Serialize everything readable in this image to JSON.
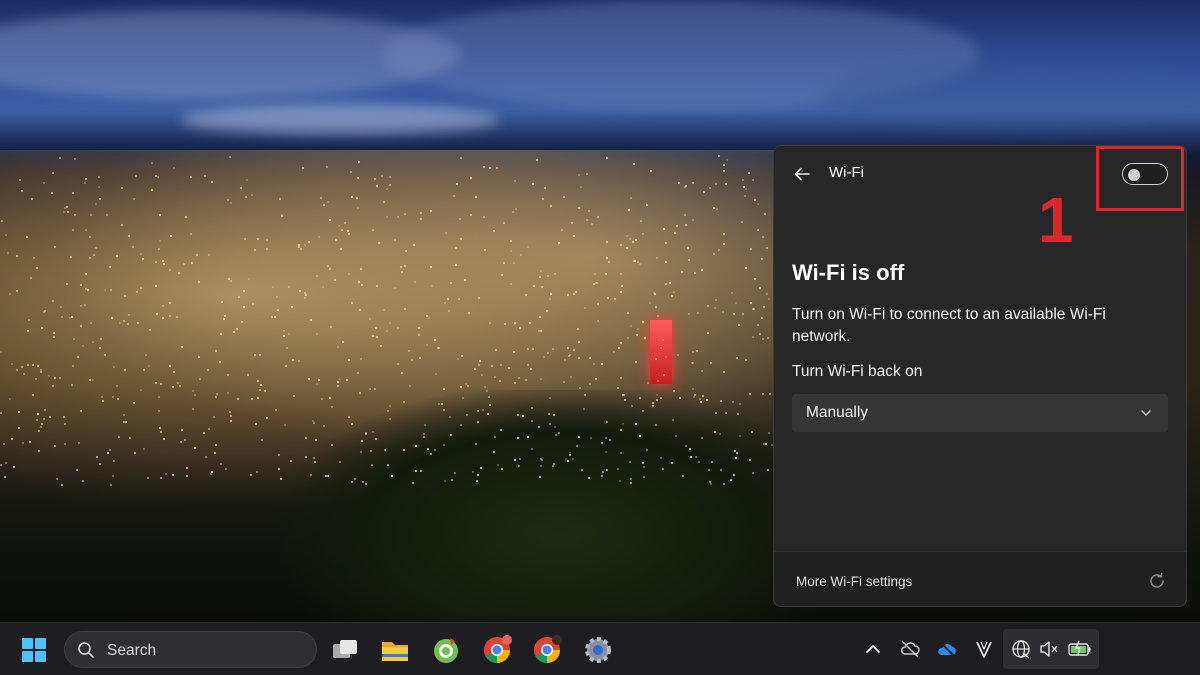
{
  "wifi_panel": {
    "title": "Wi-Fi",
    "toggle_state": "off",
    "heading": "Wi-Fi is off",
    "description": "Turn on Wi-Fi to connect to an available Wi-Fi network.",
    "turn_back_label": "Turn Wi-Fi back on",
    "turn_back_value": "Manually",
    "footer_link": "More Wi-Fi settings"
  },
  "annotation": {
    "number": "1",
    "color": "#e0262b"
  },
  "taskbar": {
    "search_placeholder": "Search",
    "pinned_apps": [
      "start-icon",
      "task-view-icon",
      "file-explorer-icon",
      "green-app-icon",
      "chrome-icon",
      "chrome-profile-icon",
      "settings-icon"
    ],
    "tray_icons": [
      "chevron-up-icon",
      "cloud-off-icon",
      "onedrive-icon",
      "v-app-icon",
      "globe-icon",
      "speaker-muted-icon",
      "battery-charging-icon"
    ]
  },
  "colors": {
    "panel_bg": "#272727",
    "footer_bg": "#202020",
    "select_bg": "#353535",
    "taskbar_bg": "#1e1e22"
  }
}
